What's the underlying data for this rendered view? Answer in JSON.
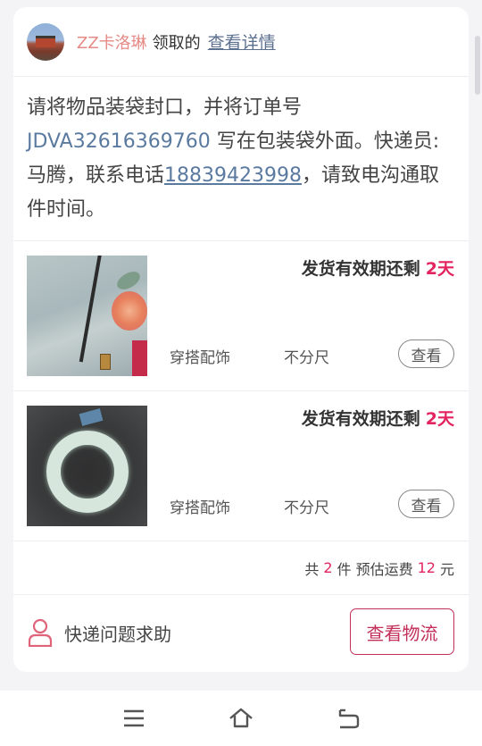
{
  "header": {
    "user_name": "ZZ卡洛琳",
    "claimed_text": "领取的",
    "detail_link": "查看详情"
  },
  "notice": {
    "text_part1": "请将物品装袋封口，并将订单号 ",
    "order_no": "JDVA32616369760",
    "text_part2": " 写在包装袋外面。快递员:马腾，联系电话",
    "phone": "18839423998",
    "text_part3": "，请致电沟通取件时间。"
  },
  "items": [
    {
      "deadline_label": "发货有效期还剩",
      "deadline_days": "2天",
      "category": "穿搭配饰",
      "size": "不分尺",
      "view_label": "查看"
    },
    {
      "deadline_label": "发货有效期还剩",
      "deadline_days": "2天",
      "category": "穿搭配饰",
      "size": "不分尺",
      "view_label": "查看"
    }
  ],
  "summary": {
    "prefix": "共",
    "count": "2",
    "unit": "件 预估运费",
    "fee": "12",
    "currency": "元"
  },
  "footer": {
    "help_text": "快递问题求助",
    "logistics_button": "查看物流"
  },
  "colors": {
    "accent": "#e4245e",
    "link": "#5b7aa0",
    "user_name": "#e58a86"
  },
  "icons": {
    "help": "person-outline-icon",
    "nav_menu": "menu-icon",
    "nav_home": "home-icon",
    "nav_back": "back-icon"
  }
}
